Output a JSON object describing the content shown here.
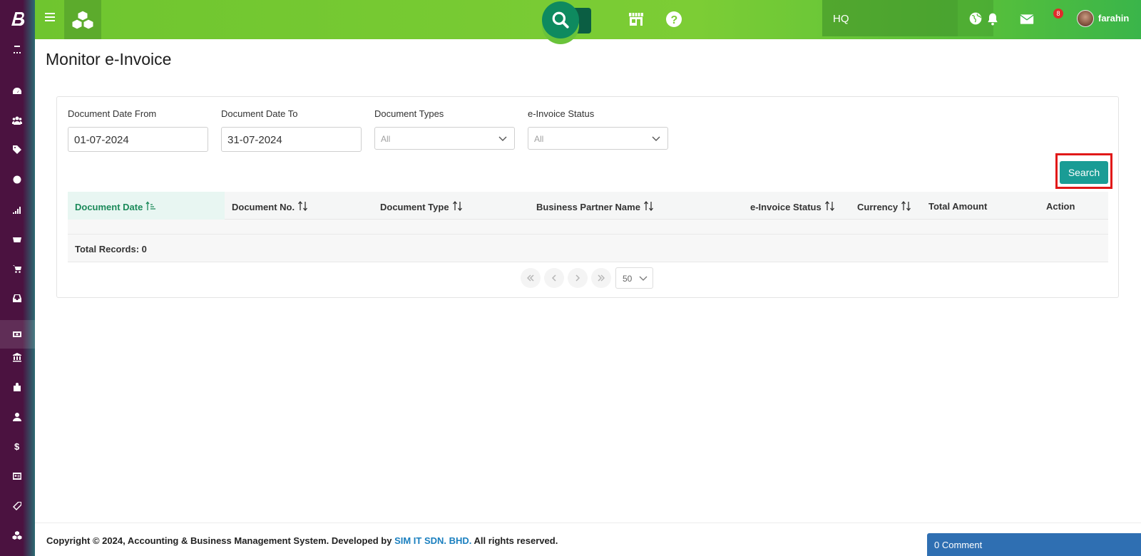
{
  "header": {
    "branch": "HQ",
    "notification_count": "8",
    "username": "farahin"
  },
  "page": {
    "title": "Monitor e-Invoice"
  },
  "filters": {
    "date_from_label": "Document Date From",
    "date_from_value": "01-07-2024",
    "date_to_label": "Document Date To",
    "date_to_value": "31-07-2024",
    "doc_types_label": "Document Types",
    "doc_types_value": "All",
    "status_label": "e-Invoice Status",
    "status_value": "All",
    "search_label": "Search"
  },
  "table": {
    "columns": [
      {
        "label": "Document Date",
        "sortable": true,
        "sorted": true
      },
      {
        "label": "Document No.",
        "sortable": true
      },
      {
        "label": "Document Type",
        "sortable": true
      },
      {
        "label": "Business Partner Name",
        "sortable": true
      },
      {
        "label": "e-Invoice Status",
        "sortable": true
      },
      {
        "label": "Currency",
        "sortable": true
      },
      {
        "label": "Total Amount",
        "sortable": false
      },
      {
        "label": "Action",
        "sortable": false
      }
    ],
    "total_records": "Total Records: 0"
  },
  "pagination": {
    "page_size": "50"
  },
  "footer": {
    "copyright_prefix": "Copyright © 2024, Accounting & Business Management System. Developed by",
    "developer": "SIM IT SDN. BHD.",
    "copyright_suffix": "All rights reserved.",
    "comment_label": "0 Comment"
  },
  "colors": {
    "header_green": "#7ccd35",
    "sidebar_purple": "#4b1240",
    "accent_teal": "#1a9c95",
    "highlight_red": "#e11919"
  }
}
